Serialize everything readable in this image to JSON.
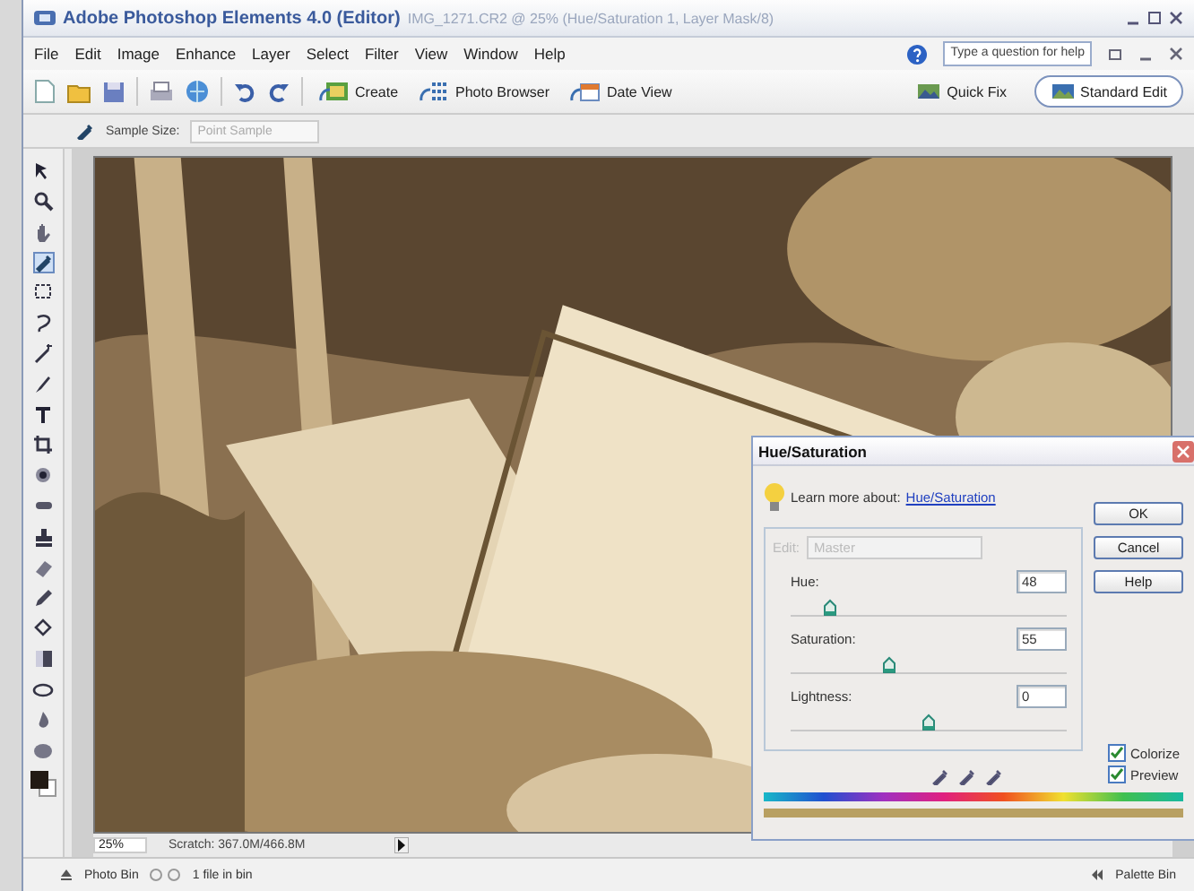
{
  "window": {
    "title": "Adobe Photoshop Elements 4.0 (Editor)",
    "document": "IMG_1271.CR2 @ 25% (Hue/Saturation 1, Layer Mask/8)"
  },
  "menu": [
    "File",
    "Edit",
    "Image",
    "Enhance",
    "Layer",
    "Select",
    "Filter",
    "View",
    "Window",
    "Help"
  ],
  "help_field": {
    "placeholder": "Type a question for help"
  },
  "toolbar": [
    {
      "label": "Create",
      "kind": "create"
    },
    {
      "label": "Photo Browser",
      "kind": "browser"
    },
    {
      "label": "Date View",
      "kind": "date"
    }
  ],
  "modes": [
    {
      "label": "Quick Fix",
      "selected": false
    },
    {
      "label": "Standard Edit",
      "selected": true
    }
  ],
  "options_bar": {
    "label": "Sample Size:",
    "value": "Point Sample"
  },
  "status_bar": {
    "zoom": "25%",
    "scratch": "Scratch: 367.0M/466.8M"
  },
  "bin_bar": {
    "photo_bin": "Photo Bin",
    "count": "1 file in bin",
    "palette_bin": "Palette Bin"
  },
  "dialog": {
    "title": "Hue/Saturation",
    "learn": "Learn more about:",
    "link": "Hue/Saturation",
    "edit_label": "Edit:",
    "edit_value": "Master",
    "edit_disabled": true,
    "sliders": [
      {
        "label": "Hue:",
        "value": "48",
        "level": 0.14
      },
      {
        "label": "Saturation:",
        "value": "55",
        "level": 0.36
      },
      {
        "label": "Lightness:",
        "value": "0",
        "level": 0.5
      }
    ],
    "buttons": [
      "OK",
      "Cancel",
      "Help"
    ],
    "checkboxes": [
      {
        "label": "Colorize",
        "checked": true
      },
      {
        "label": "Preview",
        "checked": true
      }
    ]
  }
}
